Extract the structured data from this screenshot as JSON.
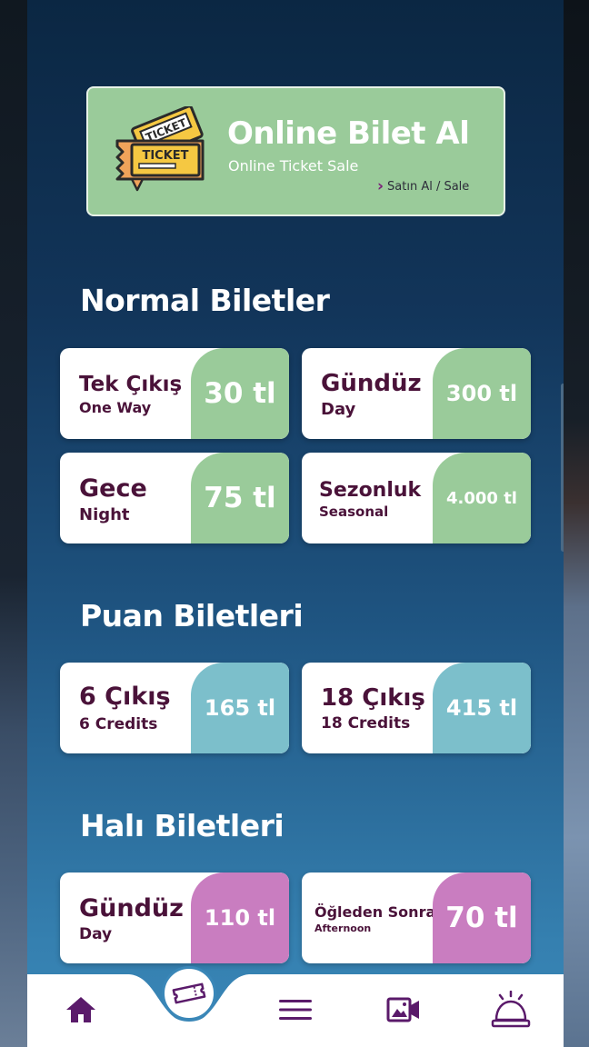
{
  "banner": {
    "title": "Online Bilet Al",
    "subtitle": "Online Ticket Sale",
    "link": "Satın Al / Sale",
    "ticket_text_1": "TICKET",
    "ticket_text_2": "TICKET"
  },
  "sections": {
    "normal": {
      "title": "Normal Biletler",
      "cards": [
        {
          "main": "Tek Çıkış",
          "sub": "One Way",
          "price": "30 tl"
        },
        {
          "main": "Gündüz",
          "sub": "Day",
          "price": "300 tl"
        },
        {
          "main": "Gece",
          "sub": "Night",
          "price": "75 tl"
        },
        {
          "main": "Sezonluk",
          "sub": "Seasonal",
          "price": "4.000 tl"
        }
      ]
    },
    "puan": {
      "title": "Puan Biletleri",
      "cards": [
        {
          "main": "6 Çıkış",
          "sub": "6 Credits",
          "price": "165 tl"
        },
        {
          "main": "18 Çıkış",
          "sub": "18 Credits",
          "price": "415 tl"
        }
      ]
    },
    "hali": {
      "title": "Halı Biletleri",
      "cards": [
        {
          "main": "Gündüz",
          "sub": "Day",
          "price": "110 tl"
        },
        {
          "main": "Öğleden Sonra",
          "sub": "Afternoon",
          "price": "70 tl"
        }
      ]
    }
  },
  "colors": {
    "accent_green": "#9acb9a",
    "accent_teal": "#7cbfcb",
    "accent_pink": "#c97dc0",
    "text_purple": "#4a1239",
    "nav_purple": "#5a1a6a"
  },
  "nav": {
    "items": [
      {
        "icon": "home-icon"
      },
      {
        "icon": "ticket-icon"
      },
      {
        "icon": "menu-icon"
      },
      {
        "icon": "media-icon"
      },
      {
        "icon": "bell-icon"
      }
    ]
  }
}
